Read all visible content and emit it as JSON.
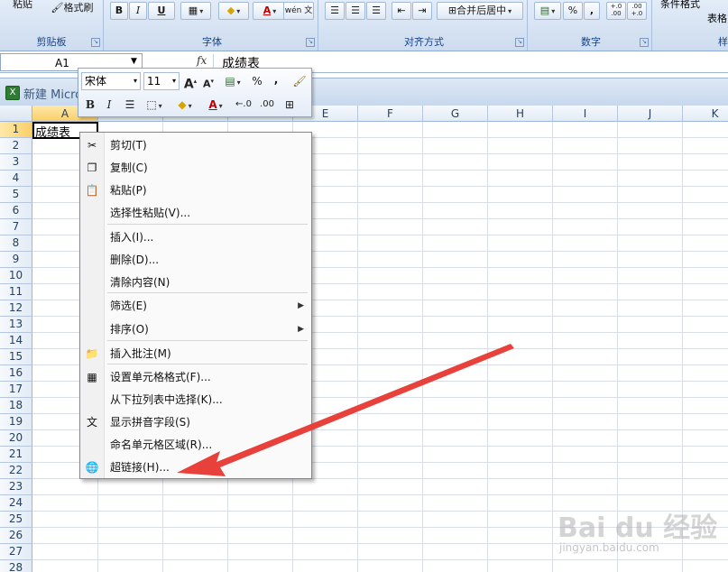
{
  "ribbon": {
    "clipboard": {
      "label": "剪贴板",
      "paste": "粘贴",
      "format_painter": "格式刷"
    },
    "font": {
      "label": "字体",
      "bold": "B",
      "italic": "I",
      "underline": "U",
      "font_color_glyph": "A",
      "phonetic": "wén 文"
    },
    "alignment": {
      "label": "对齐方式",
      "merge": "合并后居中"
    },
    "number": {
      "label": "数字",
      "percent": "%",
      "comma": ",",
      "inc_decimal": "+.0 .00",
      "dec_decimal": ".00 +.0"
    },
    "styles": {
      "label": "样",
      "conditional": "条件格式",
      "table": "表格"
    }
  },
  "formula_bar": {
    "name_box": "A1",
    "fx": "fx",
    "content": "成绩表"
  },
  "workbook": {
    "title": "新建 Micro"
  },
  "grid": {
    "columns": [
      "A",
      "B",
      "C",
      "D",
      "E",
      "F",
      "G",
      "H",
      "I",
      "J",
      "K"
    ],
    "rows": [
      "1",
      "2",
      "3",
      "4",
      "5",
      "6",
      "7",
      "8",
      "9",
      "10",
      "11",
      "12",
      "13",
      "14",
      "15",
      "16",
      "17",
      "18",
      "19",
      "20",
      "21",
      "22",
      "23",
      "24",
      "25",
      "26",
      "27",
      "28"
    ],
    "cell_a1": "成绩表"
  },
  "mini_toolbar": {
    "font_name": "宋体",
    "font_size": "11",
    "grow": "A",
    "shrink": "A",
    "percent": "%",
    "comma": ",",
    "bold": "B",
    "italic": "I",
    "font_color": "A"
  },
  "context_menu": {
    "items": [
      {
        "label": "剪切(T)",
        "icon": "scissors-icon"
      },
      {
        "label": "复制(C)",
        "icon": "copy-icon"
      },
      {
        "label": "粘贴(P)",
        "icon": "paste-icon"
      },
      {
        "label": "选择性粘贴(V)..."
      },
      {
        "label": "插入(I)..."
      },
      {
        "label": "删除(D)..."
      },
      {
        "label": "清除内容(N)"
      },
      {
        "label": "筛选(E)",
        "submenu": true
      },
      {
        "label": "排序(O)",
        "submenu": true
      },
      {
        "label": "插入批注(M)",
        "icon": "comment-icon"
      },
      {
        "label": "设置单元格格式(F)...",
        "icon": "format-cells-icon"
      },
      {
        "label": "从下拉列表中选择(K)..."
      },
      {
        "label": "显示拼音字段(S)",
        "icon": "phonetic-icon"
      },
      {
        "label": "命名单元格区域(R)..."
      },
      {
        "label": "超链接(H)...",
        "icon": "hyperlink-icon"
      }
    ]
  },
  "annotation": {
    "arrow_color": "#e8403a"
  },
  "watermark": {
    "brand": "Bai du 经验",
    "sub": "jingyan.baidu.com"
  }
}
